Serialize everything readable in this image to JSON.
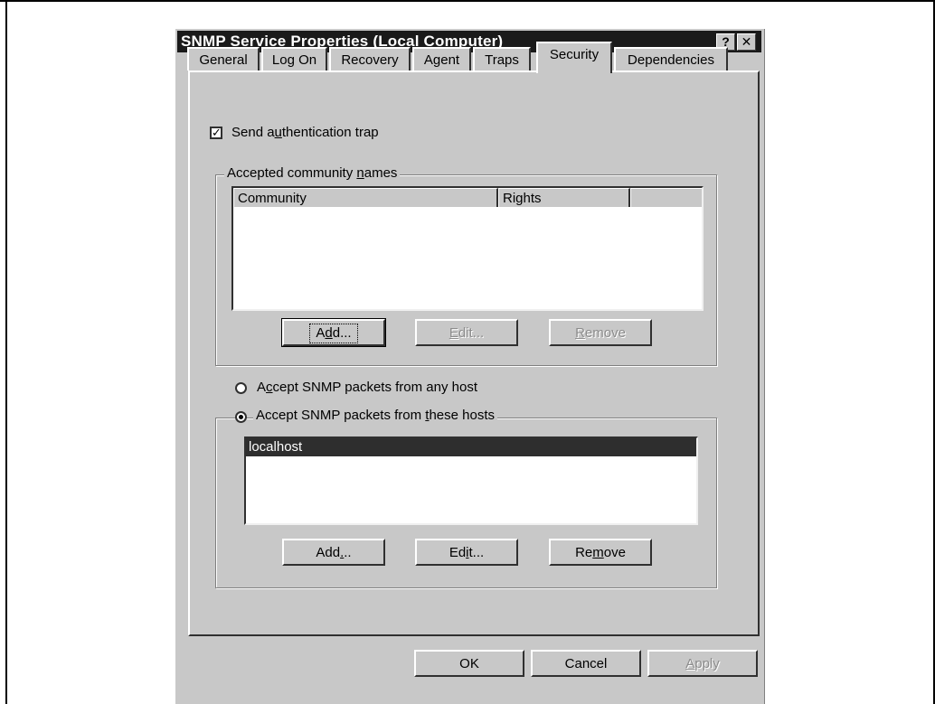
{
  "dialog": {
    "title": "SNMP Service Properties (Local Computer)",
    "help_glyph": "?",
    "close_glyph": "✕"
  },
  "tabs": [
    {
      "label": "General"
    },
    {
      "label": "Log On"
    },
    {
      "label": "Recovery"
    },
    {
      "label": "Agent"
    },
    {
      "label": "Traps"
    },
    {
      "label": "Security"
    },
    {
      "label": "Dependencies"
    }
  ],
  "active_tab": "Security",
  "security": {
    "send_auth_trap": {
      "label_pre": "Send a",
      "label_u": "u",
      "label_post": "thentication trap",
      "checked": true
    },
    "community_group": {
      "title_pre": "Accepted community ",
      "title_u": "n",
      "title_post": "ames"
    },
    "community_columns": [
      "Community",
      "Rights"
    ],
    "community_rows": [],
    "community_buttons": {
      "add": {
        "pre": "A",
        "u": "d",
        "post": "d..."
      },
      "edit": {
        "pre": "",
        "u": "E",
        "post": "dit..."
      },
      "remove": {
        "pre": "",
        "u": "R",
        "post": "emove"
      }
    },
    "radio_any": {
      "pre": "A",
      "u": "c",
      "post": "cept SNMP packets from any host",
      "selected": false
    },
    "radio_these": {
      "pre": "Accept SNMP packets from ",
      "u": "t",
      "post": "hese hosts",
      "selected": true
    },
    "hosts": [
      "localhost"
    ],
    "host_buttons": {
      "add": {
        "pre": "Add",
        "u": ".",
        "post": ".."
      },
      "edit": {
        "pre": "Ed",
        "u": "i",
        "post": "t..."
      },
      "remove": {
        "pre": "Re",
        "u": "m",
        "post": "ove"
      }
    }
  },
  "footer": {
    "ok": "OK",
    "cancel": "Cancel",
    "apply": {
      "pre": "",
      "u": "A",
      "post": "pply"
    }
  },
  "colors": {
    "titlebar": "#1a1a1a",
    "face": "#c8c8c8",
    "selection": "#2e2e2e"
  }
}
